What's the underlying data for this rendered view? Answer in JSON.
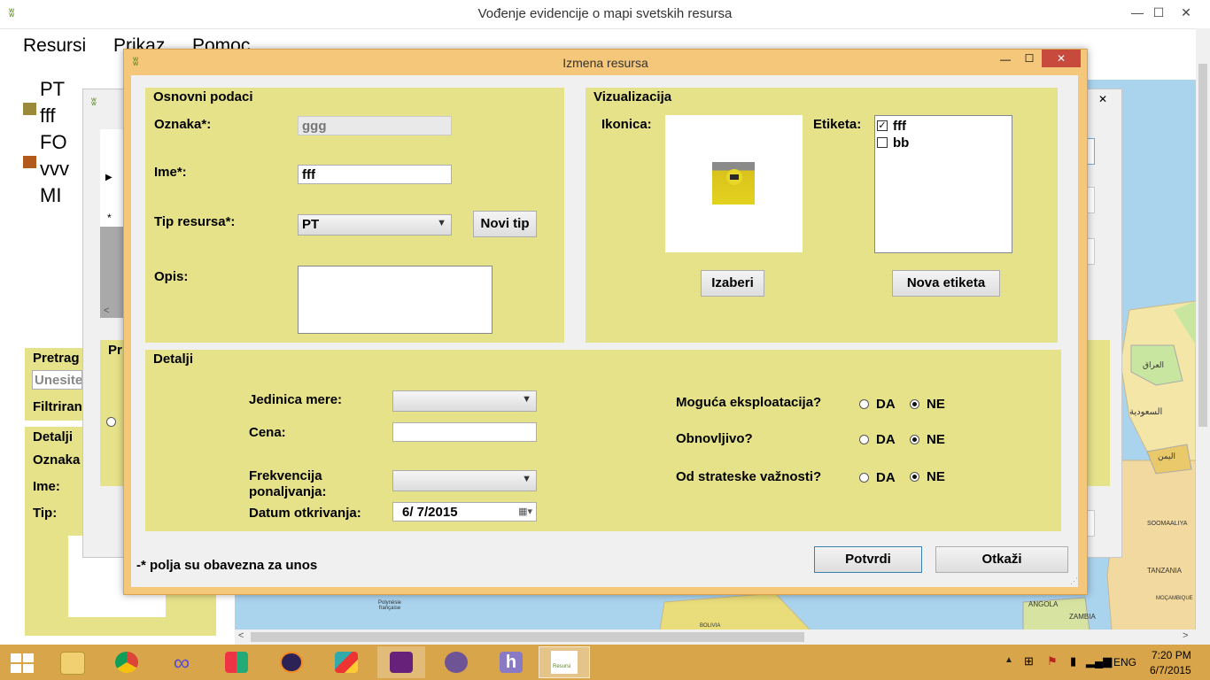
{
  "main_window": {
    "title": "Vođenje evidencije o mapi svetskih resursa",
    "minimize": "—",
    "maximize": "☐",
    "close": "✕"
  },
  "menu": {
    "items": [
      "Resursi",
      "Prikaz",
      "Pomoc"
    ]
  },
  "resource_list": {
    "items": [
      "PT",
      "fff",
      "FO",
      "vvv",
      "MI"
    ]
  },
  "left_panel": {
    "search_title": "Pretrag",
    "search_placeholder": "Unesite",
    "filter_label": "Filtriran",
    "details_title": "Detalji",
    "fields": [
      "Oznaka",
      "Ime:",
      "Tip:"
    ]
  },
  "bg_dialog": {
    "close": "✕",
    "grid_row_marker": "*",
    "group_partial": "Pr"
  },
  "map_labels": [
    "العراق",
    "السعودية",
    "اليمن",
    "TANZANIA",
    "SOOMAALIYA",
    "ANGOLA",
    "ZAMBIA",
    "Polynésie française",
    "BOLIVIA",
    "MOÇAMBIQUE"
  ],
  "edit_dialog": {
    "title": "Izmena resursa",
    "minimize": "—",
    "maximize": "☐",
    "close": "✕",
    "basic": {
      "title": "Osnovni podaci",
      "oznaka_label": "Oznaka*:",
      "oznaka_value": "ggg",
      "ime_label": "Ime*:",
      "ime_value": "fff",
      "tip_label": "Tip resursa*:",
      "tip_value": "PT",
      "new_type_button": "Novi tip",
      "opis_label": "Opis:",
      "opis_value": ""
    },
    "visual": {
      "title": "Vizualizacija",
      "icon_label": "Ikonica:",
      "choose_button": "Izaberi",
      "tag_label": "Etiketa:",
      "tags": [
        {
          "name": "fff",
          "checked": true
        },
        {
          "name": "bb",
          "checked": false
        }
      ],
      "new_tag_button": "Nova etiketa"
    },
    "details": {
      "title": "Detalji",
      "unit_label": "Jedinica mere:",
      "unit_value": "",
      "price_label": "Cena:",
      "price_value": "",
      "freq_label_1": "Frekvencija",
      "freq_label_2": "ponaljvanja:",
      "freq_value": "",
      "date_label": "Datum otkrivanja:",
      "date_value": "6/  7/2015",
      "q1": "Moguća eksploatacija?",
      "q2": "Obnovljivo?",
      "q3": "Od strateske važnosti?",
      "yes": "DA",
      "no": "NE",
      "q1_answer": "NE",
      "q2_answer": "NE",
      "q3_answer": "NE"
    },
    "required_note": "-* polja su obavezna za unos",
    "confirm_button": "Potvrdi",
    "cancel_button": "Otkaži"
  },
  "taskbar": {
    "apps": [
      "start",
      "file-explorer",
      "chrome",
      "visual-studio-infinity",
      "office",
      "eclipse",
      "paint",
      "visual-studio",
      "github",
      "heroku",
      "resursi-app"
    ],
    "active_app_label": "Resursi",
    "language": "ENG",
    "time": "7:20 PM",
    "date": "6/7/2015"
  },
  "colors": {
    "panel_yellow": "#e6e28a",
    "dialog_frame": "#f4c77a",
    "taskbar": "#d8a54b",
    "close_red": "#c74a3c",
    "map_sea": "#aad3ee"
  }
}
